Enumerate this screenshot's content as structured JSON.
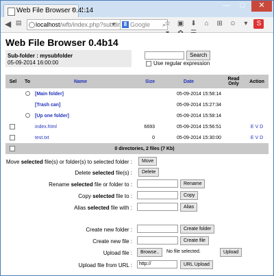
{
  "browser": {
    "tab_title": "Web File Browser 0.4b14",
    "tab_close": "×",
    "new_tab": "+",
    "url_host": "localhost",
    "url_path": "/wfb/index.php?subdir=mysubfolc",
    "search_engine": "Google",
    "search_engine_letter": "8",
    "window_controls": {
      "minimize": "—",
      "maximize": "□",
      "close": "✕"
    }
  },
  "page": {
    "title": "Web File Browser 0.4b14",
    "subfolder_label": "Sub-folder : mysubfolder",
    "subfolder_date": "05-09-2014 16:00:00",
    "search_button": "Search",
    "regex_label": "Use regular expression"
  },
  "table": {
    "headers": {
      "sel": "Sel",
      "to": "To",
      "name": "Name",
      "size": "Size",
      "date": "Date",
      "readonly": "Read Only",
      "action": "Action"
    },
    "rows": [
      {
        "name": "[Main folder]",
        "size": "",
        "date": "05-09-2014 15:58:14",
        "action": ""
      },
      {
        "name": "[Trash can]",
        "size": "",
        "date": "05-09-2014 15:27:34",
        "action": ""
      },
      {
        "name": "[Up one folder]",
        "size": "",
        "date": "05-09-2014 15:58:14",
        "action": ""
      },
      {
        "name": "index.html",
        "size": "6693",
        "date": "05-09-2014 15:56:51",
        "action": "E V D"
      },
      {
        "name": "test.txt",
        "size": "0",
        "date": "05-09-2014 15:30:00",
        "action": "E V D"
      }
    ],
    "summary": "0 directories, 2 files (7 Kb)"
  },
  "form": {
    "move_label_pre": "Move ",
    "move_label_bold": "selected",
    "move_label_post": " file(s) or folder(s) to selected folder :",
    "move_button": "Move",
    "delete_label_pre": "Delete ",
    "delete_label_bold": "selected",
    "delete_label_post": " file(s) :",
    "delete_button": "Delete",
    "rename_label_pre": "Rename ",
    "rename_label_bold": "selected",
    "rename_label_post": " file or folder to :",
    "rename_button": "Rename",
    "copy_label_pre": "Copy ",
    "copy_label_bold": "selected",
    "copy_label_post": " file to :",
    "copy_button": "Copy",
    "alias_label_pre": "Alias ",
    "alias_label_bold": "selected",
    "alias_label_post": " file with :",
    "alias_button": "Alias",
    "create_folder_label": "Create new folder :",
    "create_folder_button": "Create folder",
    "create_file_label": "Create new file :",
    "create_file_button": "Create file",
    "upload_label": "Upload file :",
    "browse_button": "Browse..",
    "no_file_text": "No file selected.",
    "upload_button": "Upload",
    "upload_url_label": "Upload file from URL :",
    "upload_url_value": "http://",
    "url_upload_button": "URL Upload"
  }
}
